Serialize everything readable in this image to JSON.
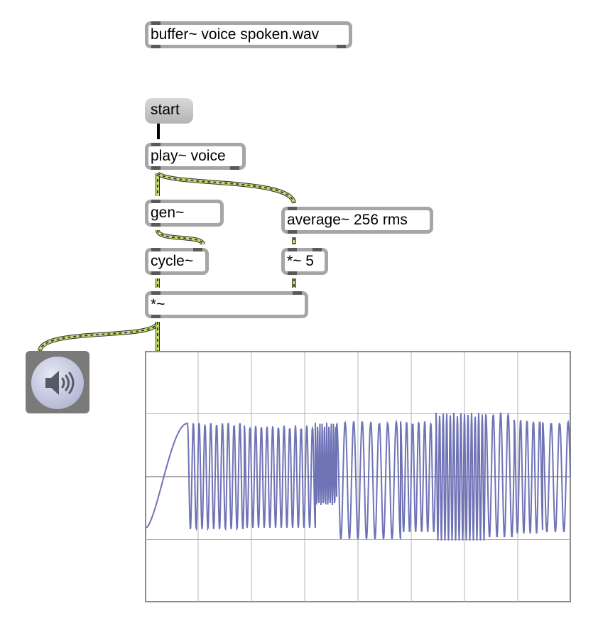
{
  "patch": {
    "buffer_object": "buffer~ voice spoken.wav",
    "start_message": "start",
    "play_object": "play~ voice",
    "gen_object": "gen~",
    "average_object": "average~ 256 rms",
    "cycle_object": "cycle~",
    "mult5_object": "*~ 5",
    "mult_object": "*~",
    "dac_icon": "speaker-icon"
  },
  "colors": {
    "signal_cable": "#c7e06b",
    "signal_cable_dash": "#3d3d3d",
    "control_cable": "#000000",
    "box_border": "#a6a6a6",
    "port": "#595959",
    "scope_trace": "#6f73b6",
    "scope_grid": "#b5b5b5",
    "dac_background": "#7a7a7a"
  },
  "scope": {
    "trace": "signal waveform",
    "grid": true,
    "vertical_divisions": 8,
    "horizontal_divisions": 4
  }
}
